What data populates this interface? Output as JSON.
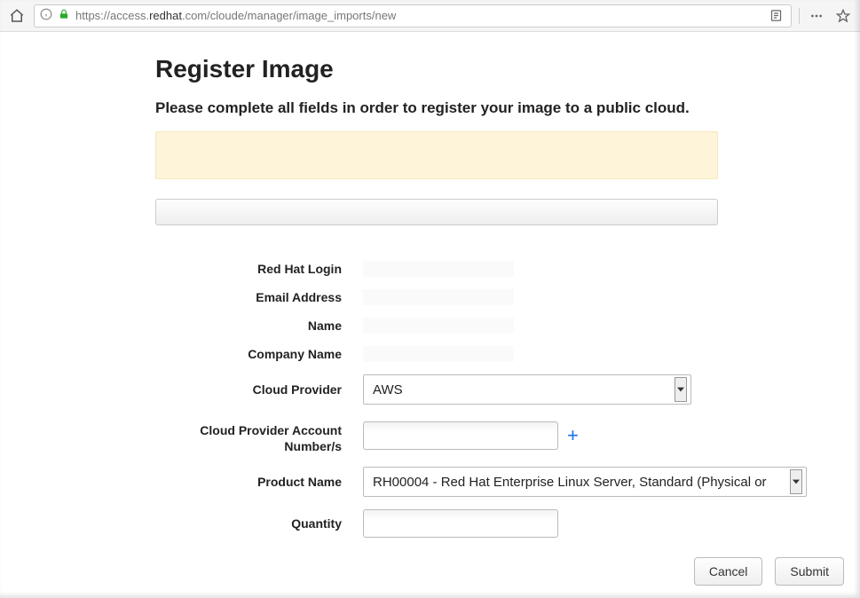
{
  "browser": {
    "url_prefix": "https://access.",
    "url_bold": "redhat",
    "url_suffix": ".com/cloude/manager/image_imports/new"
  },
  "page": {
    "title": "Register Image",
    "subheading": "Please complete all fields in order to register your image to a public cloud."
  },
  "form": {
    "labels": {
      "login": "Red Hat Login",
      "email": "Email Address",
      "name": "Name",
      "company": "Company Name",
      "provider": "Cloud Provider",
      "account": "Cloud Provider Account Number/s",
      "product": "Product Name",
      "quantity": "Quantity"
    },
    "values": {
      "login": "",
      "email": "",
      "name": "",
      "company": "",
      "provider": "AWS",
      "account": "",
      "product": "RH00004 - Red Hat Enterprise Linux Server, Standard (Physical or",
      "quantity": ""
    }
  },
  "buttons": {
    "cancel": "Cancel",
    "submit": "Submit",
    "add": "+"
  }
}
